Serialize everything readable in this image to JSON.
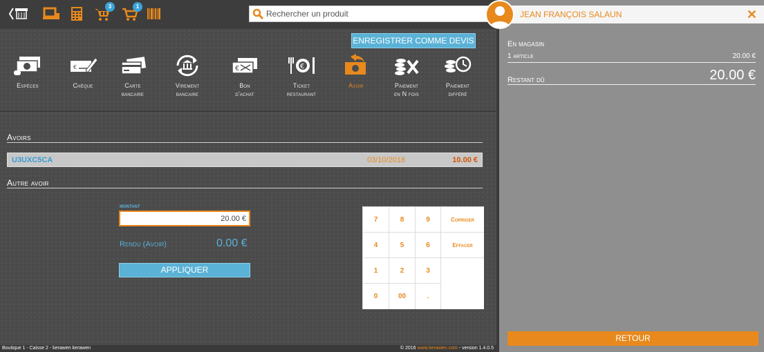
{
  "topbar": {
    "badges": {
      "cart_count": "3",
      "order_count": "1"
    },
    "search_placeholder": "Rechercher un produit"
  },
  "save_quote_label": "ENREGISTRER COMME DEVIS",
  "payment_methods": [
    {
      "line1": "Espèces",
      "line2": ""
    },
    {
      "line1": "Chèque",
      "line2": ""
    },
    {
      "line1": "Carte",
      "line2": "bancaire"
    },
    {
      "line1": "Virement",
      "line2": "bancaire"
    },
    {
      "line1": "Bon",
      "line2": "d'achat"
    },
    {
      "line1": "Ticket",
      "line2": "restaurant"
    },
    {
      "line1": "Avoir",
      "line2": ""
    },
    {
      "line1": "Paiement",
      "line2": "en N fois"
    },
    {
      "line1": "Paiement",
      "line2": "différé"
    }
  ],
  "active_method": "Avoir",
  "credits": {
    "title": "Avoirs",
    "items": [
      {
        "code": "U3UXC5CA",
        "date": "03/10/2018",
        "amount": "10.00 €"
      }
    ]
  },
  "other_credit": {
    "title": "Autre avoir",
    "amount_label": "MONTANT",
    "amount_value": "20.00 €",
    "change_label": "Rendu (Avoir)",
    "change_value": "0.00 €",
    "apply_label": "APPLIQUER"
  },
  "keypad": {
    "keys": [
      "7",
      "8",
      "9",
      "4",
      "5",
      "6",
      "1",
      "2",
      "3",
      "0",
      "00",
      "."
    ],
    "correct_label": "Corriger",
    "clear_label": "Effacer"
  },
  "footer": {
    "left": "Boutique 1 - Caisse 2 - kerawen kerawen",
    "right_prefix": "© 2016",
    "right_link": "www.kerawen.com",
    "right_suffix": "- version 1.4.0.5"
  },
  "customer": {
    "name": "JEAN FRANÇOIS SALAUN"
  },
  "summary": {
    "location": "En magasin",
    "articles_label": "1 article",
    "articles_total": "20.00 €",
    "remaining_label": "Restant dû",
    "remaining_value": "20.00 €"
  },
  "return_label": "RETOUR",
  "colors": {
    "accent": "#e8891d",
    "info": "#5ab2d6",
    "panel": "#8f8f8f"
  },
  "icons": [
    "back-shop-icon",
    "pos-screen-icon",
    "calculator-icon",
    "cart-icon",
    "basket-icon",
    "barcode-icon",
    "search-icon",
    "user-icon",
    "close-icon"
  ]
}
